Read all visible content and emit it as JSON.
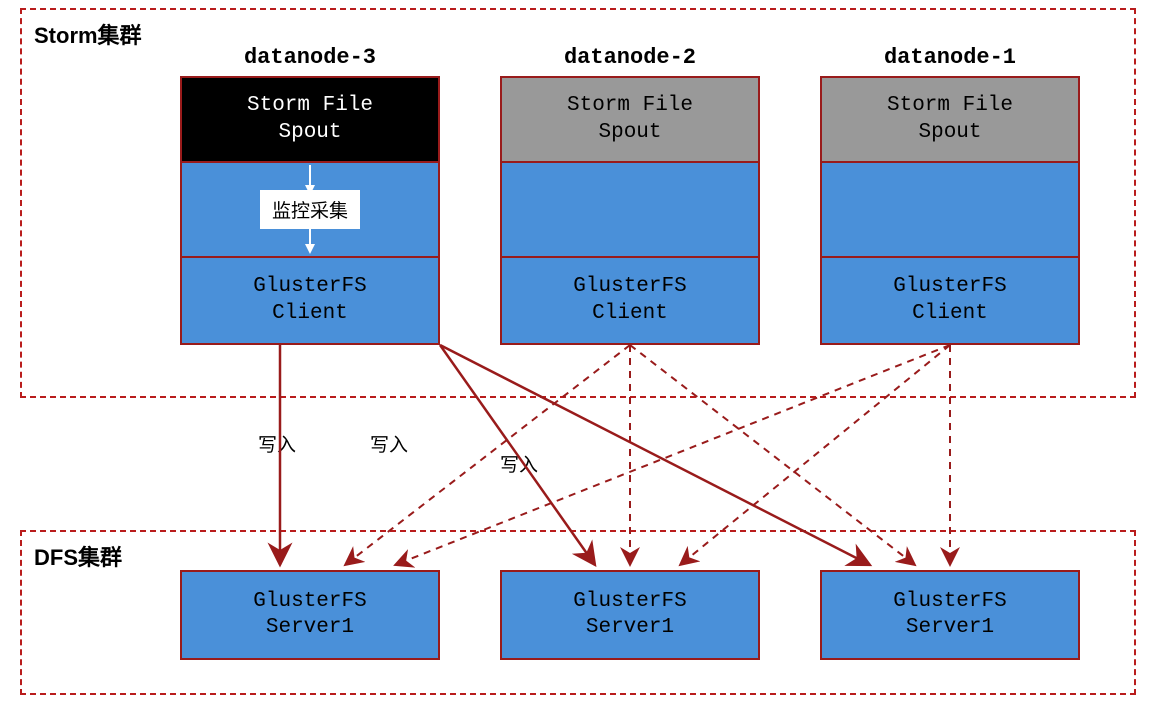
{
  "storm_cluster": {
    "label": "Storm集群",
    "nodes": [
      {
        "title": "datanode-3",
        "spout": "Storm File\nSpout",
        "mid_label": "监控采集",
        "client": "GlusterFS\nClient",
        "active": true
      },
      {
        "title": "datanode-2",
        "spout": "Storm File\nSpout",
        "client": "GlusterFS\nClient",
        "active": false
      },
      {
        "title": "datanode-1",
        "spout": "Storm File\nSpout",
        "client": "GlusterFS\nClient",
        "active": false
      }
    ]
  },
  "dfs_cluster": {
    "label": "DFS集群",
    "servers": [
      {
        "label": "GlusterFS\nServer1"
      },
      {
        "label": "GlusterFS\nServer1"
      },
      {
        "label": "GlusterFS\nServer1"
      }
    ]
  },
  "edges": {
    "write1": "写入",
    "write2": "写入",
    "write3": "写入"
  },
  "colors": {
    "border": "#991b1b",
    "dashed": "#b91c1c",
    "fill": "#4a90d9",
    "inactive": "#999999"
  }
}
